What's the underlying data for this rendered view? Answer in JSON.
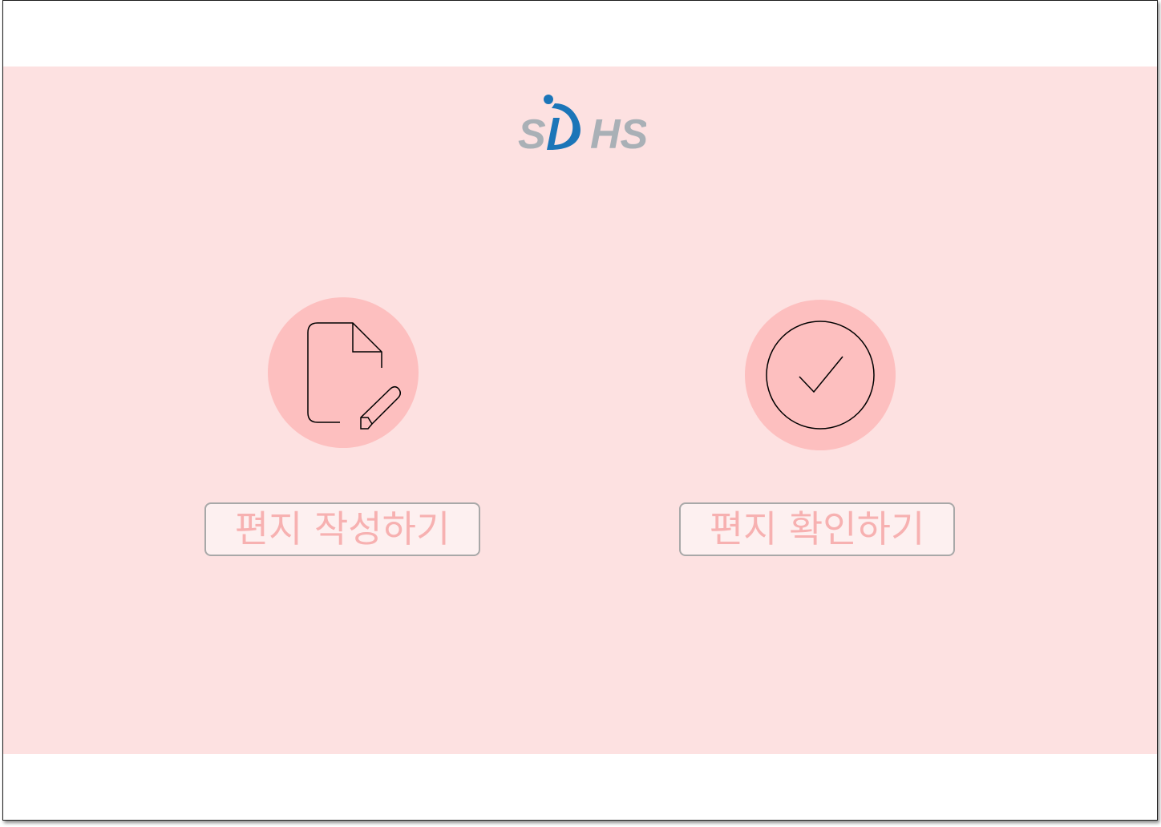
{
  "app": {
    "logo_text": "SDHS",
    "logo_icon": "sdhs-logo",
    "colors": {
      "background": "#fde1e1",
      "circle": "#fdbfbf",
      "button_bg": "#fdf0f0",
      "button_text": "#f7b1b1",
      "button_border": "#a8a8a8",
      "logo_gray": "#a9b0b6",
      "logo_blue": "#1b75b8"
    }
  },
  "actions": {
    "write": {
      "label": "편지 작성하기",
      "icon": "document-edit-icon"
    },
    "check": {
      "label": "편지 확인하기",
      "icon": "check-circle-icon"
    }
  }
}
